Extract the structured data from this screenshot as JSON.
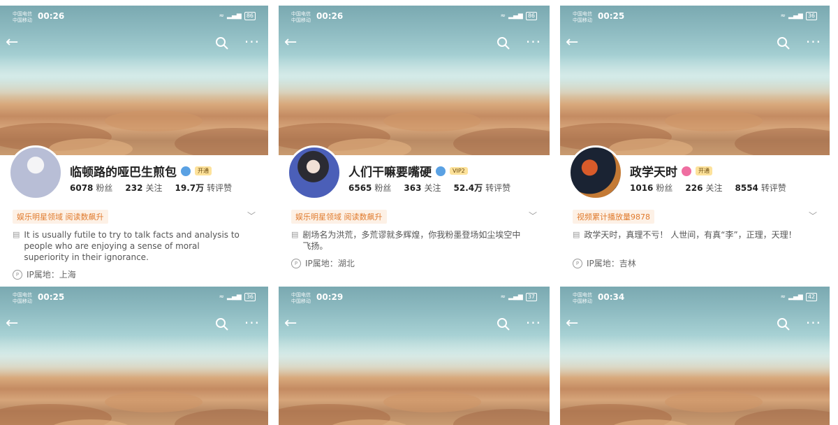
{
  "panels": [
    {
      "status": {
        "carrier_line1": "中国电信",
        "carrier_line2": "中国移动",
        "time": "00:26",
        "battery": "86"
      },
      "profile": {
        "name": "临顿路的哑巴生煎包",
        "vip": "开通",
        "fans_count": "6078",
        "fans_label": "粉丝",
        "follow_count": "232",
        "follow_label": "关注",
        "likes_count": "19.7万",
        "likes_label": "转评赞",
        "tag": "娱乐明星领域 阅读数飙升",
        "bio": "It is usually futile to try to talk facts and analysis to people who are enjoying a sense of moral superiority in their ignorance.",
        "ip": "IP属地：上海"
      }
    },
    {
      "status": {
        "carrier_line1": "中国电信",
        "carrier_line2": "中国移动",
        "time": "00:26",
        "battery": "86"
      },
      "profile": {
        "name": "人们干嘛要嘴硬",
        "vip": "VIP2",
        "fans_count": "6565",
        "fans_label": "粉丝",
        "follow_count": "363",
        "follow_label": "关注",
        "likes_count": "52.4万",
        "likes_label": "转评赞",
        "tag": "娱乐明星领域 阅读数飙升",
        "bio": "剧场名为洪荒，多荒谬就多辉煌，你我粉墨登场如尘埃空中飞扬。",
        "ip": "IP属地：湖北"
      }
    },
    {
      "status": {
        "carrier_line1": "中国电信",
        "carrier_line2": "中国移动",
        "time": "00:25",
        "battery": "36"
      },
      "profile": {
        "name": "政学天时",
        "vip": "开通",
        "fans_count": "1016",
        "fans_label": "粉丝",
        "follow_count": "226",
        "follow_label": "关注",
        "likes_count": "8554",
        "likes_label": "转评赞",
        "tag": "视频累计播放量9878",
        "bio": "政学天时，真理不亏！ 人世间，有真“李”，正理，天理！",
        "ip": "IP属地：吉林"
      }
    },
    {
      "status": {
        "carrier_line1": "中国电信",
        "carrier_line2": "中国移动",
        "time": "00:25",
        "battery": "36"
      }
    },
    {
      "status": {
        "carrier_line1": "中国电信",
        "carrier_line2": "中国移动",
        "time": "00:29",
        "battery": "37"
      }
    },
    {
      "status": {
        "carrier_line1": "中国电信",
        "carrier_line2": "中国移动",
        "time": "00:34",
        "battery": "42"
      }
    }
  ],
  "icons": {
    "back": "arrow-left-icon",
    "search": "search-icon",
    "more": "more-icon"
  }
}
